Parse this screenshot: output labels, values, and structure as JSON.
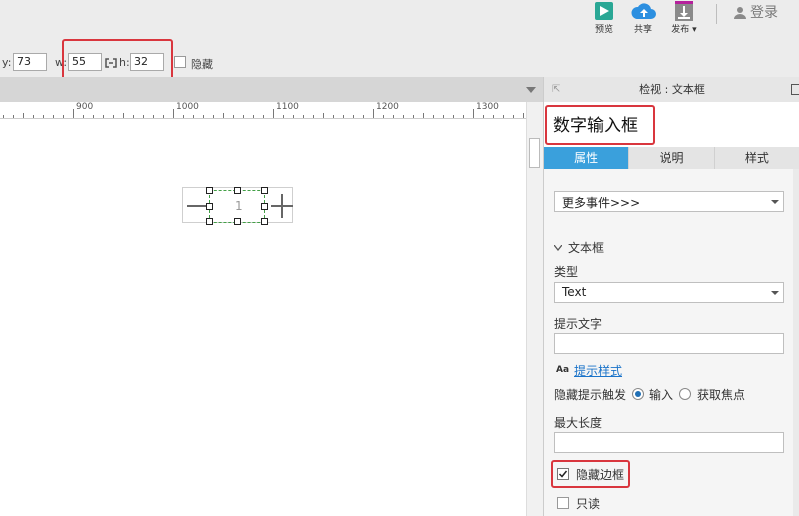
{
  "toolbar": {
    "preview_label": "预览",
    "share_label": "共享",
    "publish_label": "发布 ▾",
    "login_label": "登录"
  },
  "props": {
    "y_label": "y:",
    "y_value": "73",
    "w_label": "w:",
    "w_value": "55",
    "h_label": "h:",
    "h_value": "32",
    "hide_label": "隐藏"
  },
  "ruler": {
    "marks": [
      "900",
      "1000",
      "1100",
      "1200",
      "1300"
    ]
  },
  "stepper": {
    "value": "1"
  },
  "panel": {
    "header": "检视 : 文本框",
    "widget_name": "数字输入框",
    "tabs": [
      {
        "label": "属性"
      },
      {
        "label": "说明"
      },
      {
        "label": "样式"
      }
    ],
    "more_events": "更多事件>>>",
    "section_title": "文本框",
    "type_label": "类型",
    "type_value": "Text",
    "hint_label": "提示文字",
    "hint_style_link": "提示样式",
    "hide_hint_label": "隐藏提示触发",
    "radio_input": "输入",
    "radio_focus": "获取焦点",
    "maxlen_label": "最大长度",
    "hide_border_label": "隐藏边框",
    "readonly_label": "只读"
  }
}
